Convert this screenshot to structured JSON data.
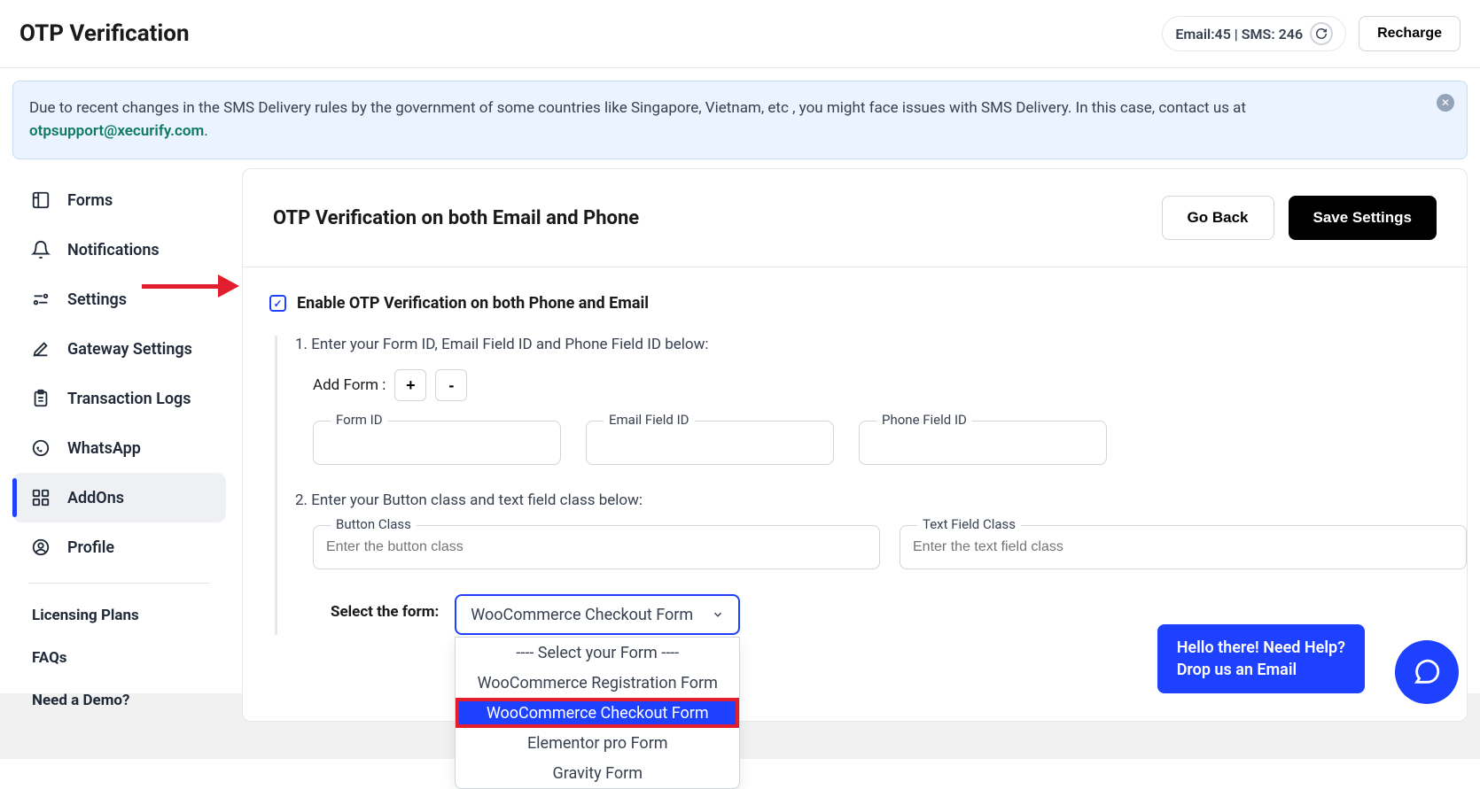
{
  "header": {
    "title": "OTP Verification",
    "quota": "Email:45 | SMS: 246",
    "recharge": "Recharge"
  },
  "notice": {
    "text_prefix": "Due to recent changes in the SMS Delivery rules by the government of some countries like Singapore, Vietnam, etc , you might face issues with SMS Delivery. In this case, contact us at ",
    "email": "otpsupport@xecurify.com",
    "period": "."
  },
  "sidebar": {
    "items": [
      {
        "label": "Forms"
      },
      {
        "label": "Notifications"
      },
      {
        "label": "Settings"
      },
      {
        "label": "Gateway Settings"
      },
      {
        "label": "Transaction Logs"
      },
      {
        "label": "WhatsApp"
      },
      {
        "label": "AddOns"
      },
      {
        "label": "Profile"
      }
    ],
    "links": [
      {
        "label": "Licensing Plans"
      },
      {
        "label": "FAQs"
      },
      {
        "label": "Need a Demo?"
      }
    ]
  },
  "panel": {
    "title": "OTP Verification on both Email and Phone",
    "go_back": "Go Back",
    "save": "Save Settings",
    "enable_label": "Enable OTP Verification on both Phone and Email",
    "step1": "1. Enter your Form ID, Email Field ID and Phone Field ID below:",
    "add_form": "Add Form :",
    "plus": "+",
    "minus": "-",
    "form_id": "Form ID",
    "email_field_id": "Email Field ID",
    "phone_field_id": "Phone Field ID",
    "step2": "2. Enter your Button class and text field class below:",
    "button_class": "Button Class",
    "button_class_ph": "Enter the button class",
    "text_field_class": "Text Field Class",
    "text_field_class_ph": "Enter the text field class",
    "select_label": "Select the form:",
    "select_value": "WooCommerce Checkout Form",
    "options": [
      "---- Select your Form ----",
      "WooCommerce Registration Form",
      "WooCommerce Checkout Form",
      "Elementor pro Form",
      "Gravity Form"
    ]
  },
  "help": {
    "line1": "Hello there! Need Help?",
    "line2": "Drop us an Email"
  }
}
